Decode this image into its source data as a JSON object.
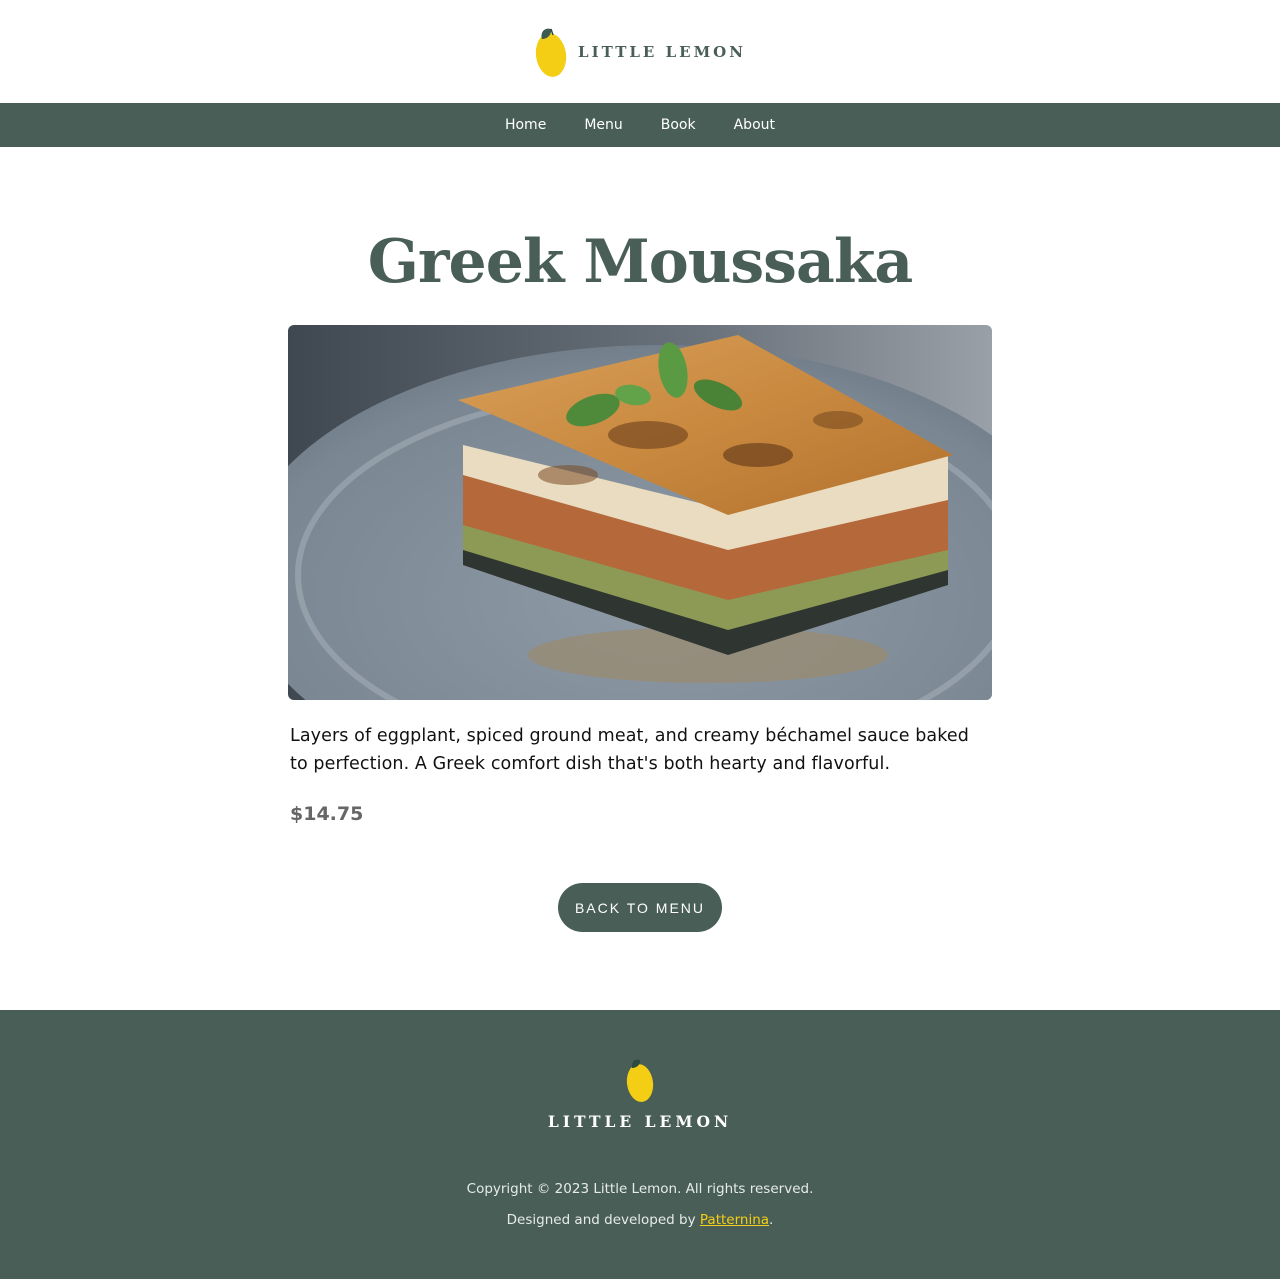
{
  "brand": {
    "name": "LITTLE LEMON",
    "logo_icon": "lemon-icon",
    "lemon_color": "#f4ce14"
  },
  "nav": {
    "items": [
      {
        "label": "Home"
      },
      {
        "label": "Menu"
      },
      {
        "label": "Book"
      },
      {
        "label": "About"
      }
    ]
  },
  "dish": {
    "title": "Greek Moussaka",
    "description": "Layers of eggplant, spiced ground meat, and creamy béchamel sauce baked to perfection. A Greek comfort dish that's both hearty and flavorful.",
    "price": "$14.75"
  },
  "actions": {
    "back_label": "BACK TO MENU"
  },
  "footer": {
    "brand": "LITTLE LEMON",
    "copyright": "Copyright © 2023 Little Lemon. All rights reserved.",
    "credit_prefix": "Designed and developed by ",
    "credit_link": "Patternina",
    "credit_suffix": "."
  },
  "colors": {
    "primary": "#495e57",
    "accent": "#f4ce14",
    "background": "#ffffff"
  }
}
